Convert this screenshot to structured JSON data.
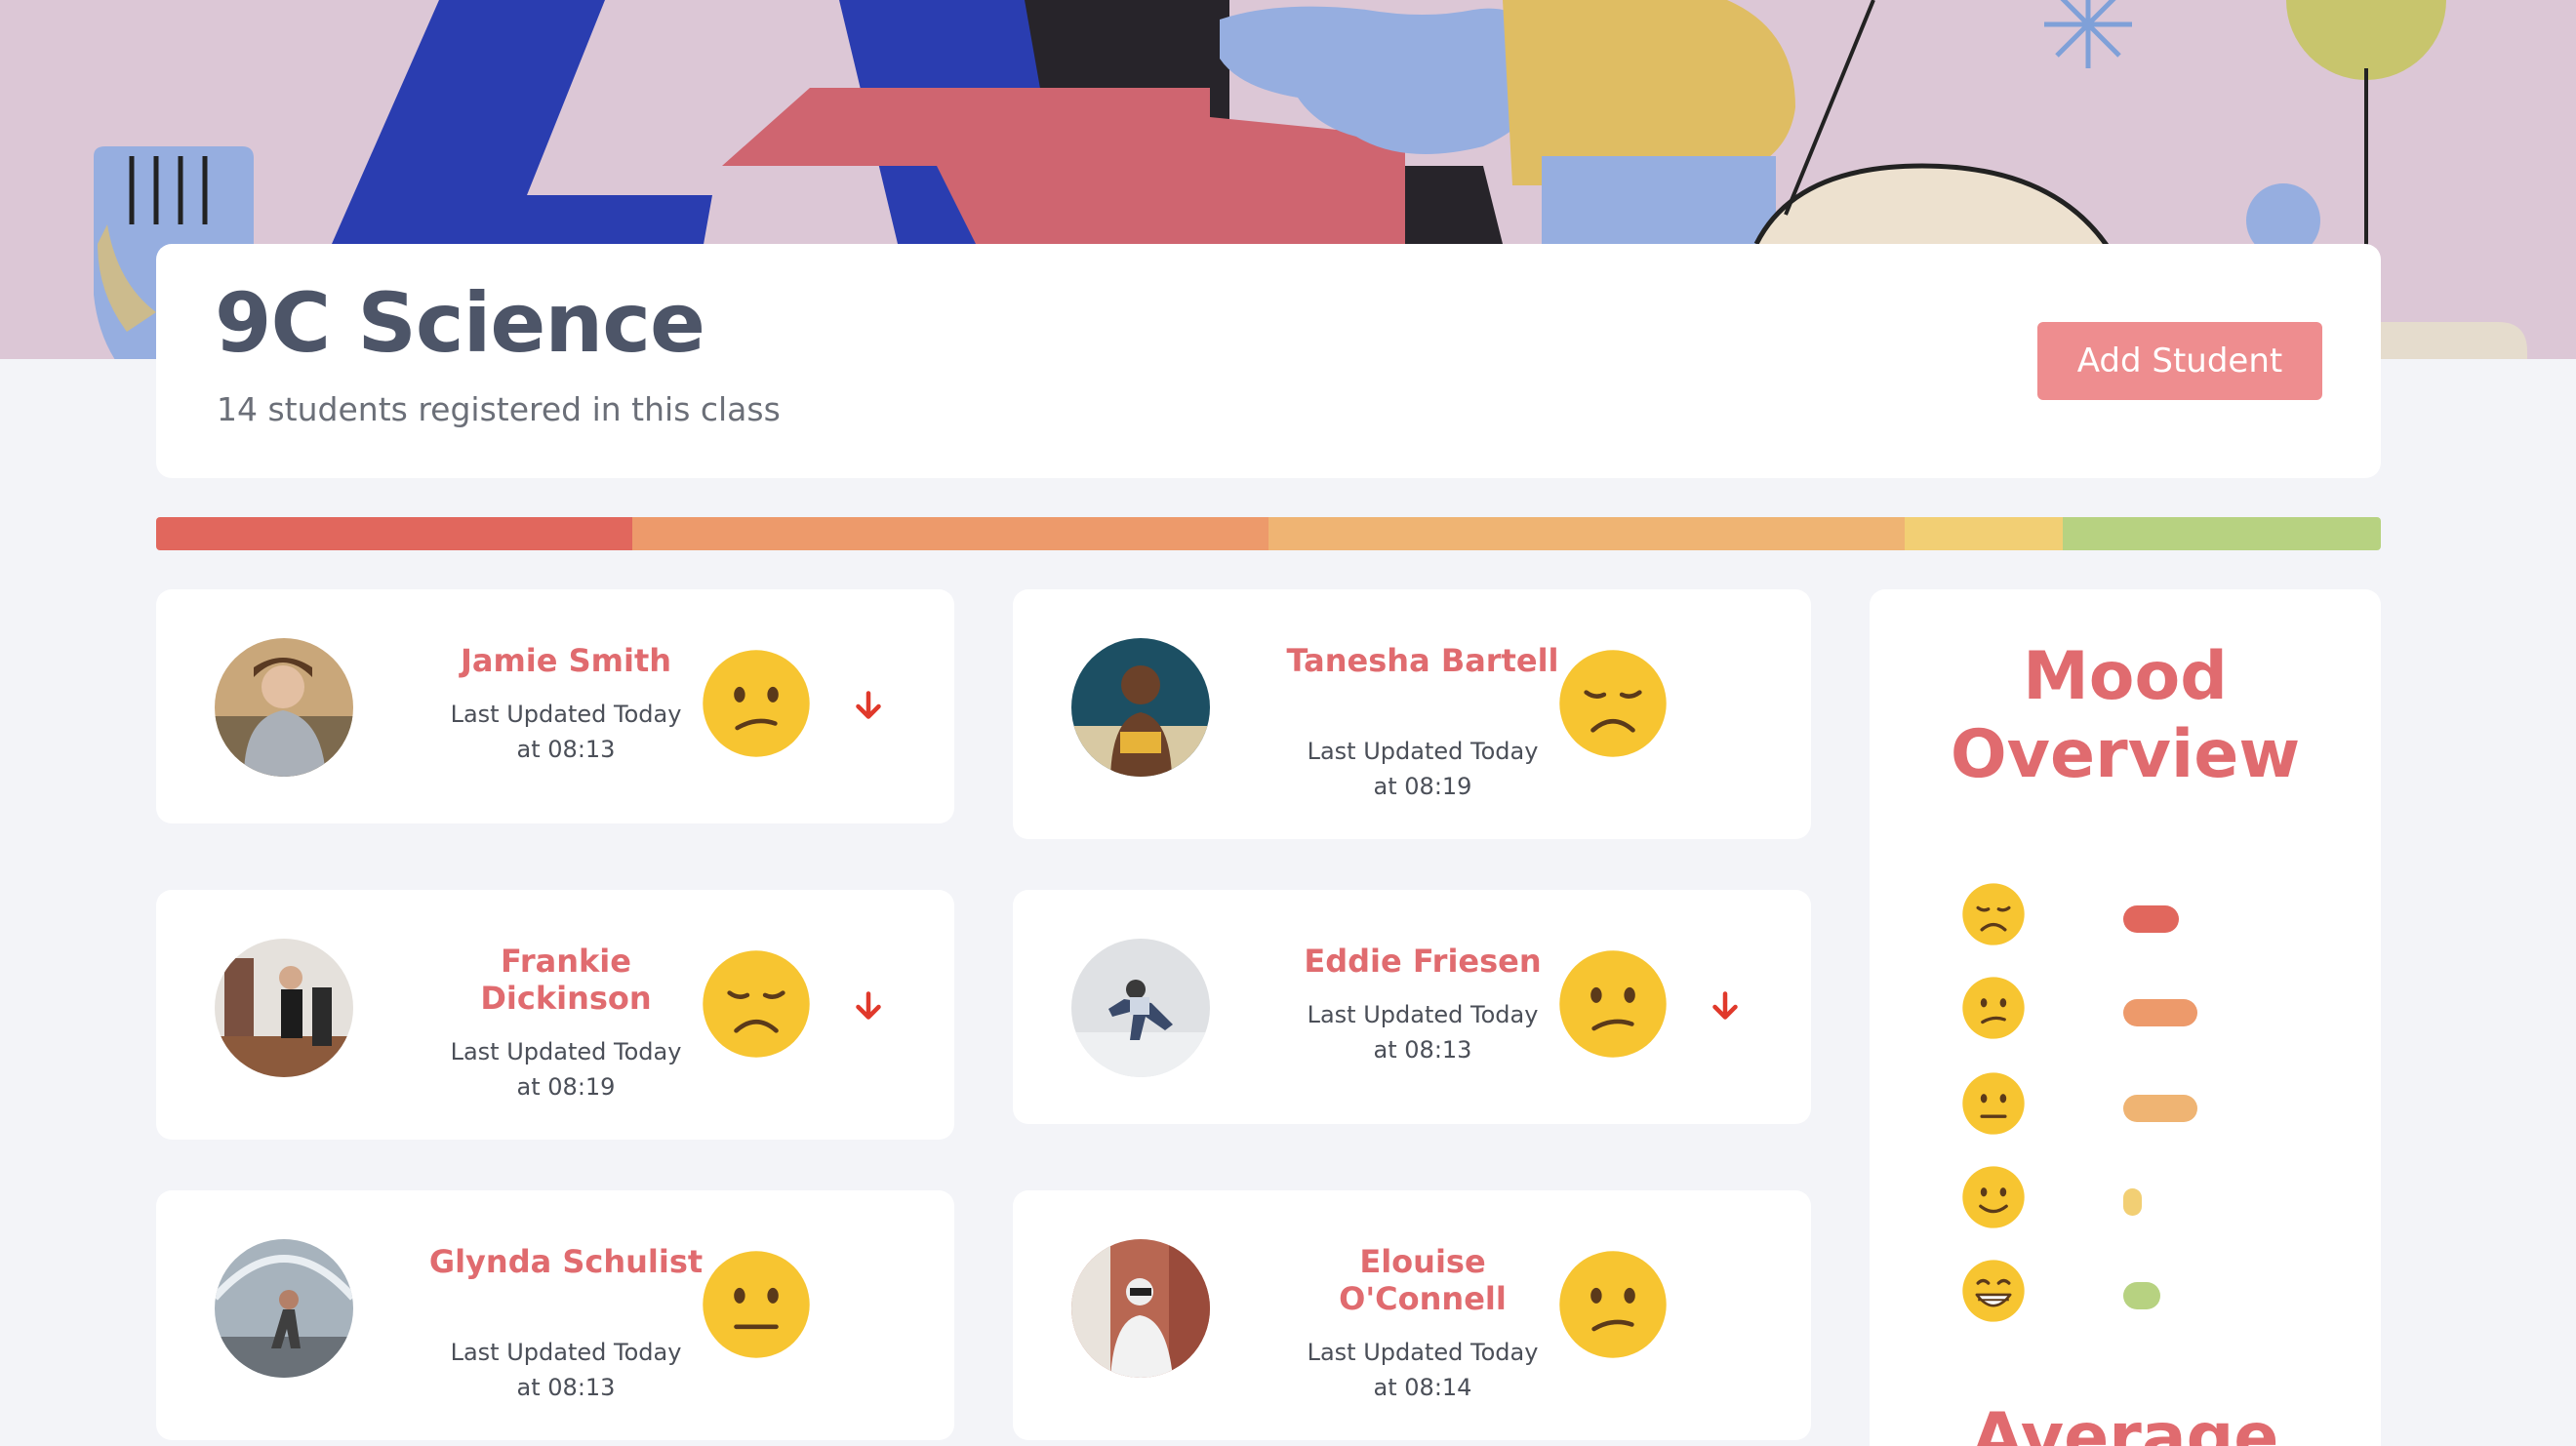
{
  "class": {
    "title": "9C Science",
    "subtitle": "14 students registered in this class",
    "add_button_label": "Add Student"
  },
  "mood_strip": [
    {
      "mood": "sad",
      "fraction": 0.214,
      "color": "#e1675d"
    },
    {
      "mood": "confused",
      "fraction": 0.286,
      "color": "#ed9a6b"
    },
    {
      "mood": "neutral",
      "fraction": 0.286,
      "color": "#efb473"
    },
    {
      "mood": "slightly-smiling",
      "fraction": 0.071,
      "color": "#f2cf74"
    },
    {
      "mood": "grinning",
      "fraction": 0.143,
      "color": "#b7d281"
    }
  ],
  "students": [
    {
      "name": "Jamie Smith",
      "updated_line1": "Last Updated Today",
      "updated_line2": "at 08:13",
      "mood": "confused-face-icon",
      "trend": "down"
    },
    {
      "name": "Tanesha Bartell",
      "updated_line1": "Last Updated Today",
      "updated_line2": "at 08:19",
      "mood": "disappointed-face-icon",
      "trend": "none"
    },
    {
      "name": "Frankie Dickinson",
      "updated_line1": "Last Updated Today",
      "updated_line2": "at 08:19",
      "mood": "disappointed-face-icon",
      "trend": "down"
    },
    {
      "name": "Eddie Friesen",
      "updated_line1": "Last Updated Today",
      "updated_line2": "at 08:13",
      "mood": "confused-face-icon",
      "trend": "down"
    },
    {
      "name": "Glynda Schulist",
      "updated_line1": "Last Updated Today",
      "updated_line2": "at 08:13",
      "mood": "neutral-face-icon",
      "trend": "none"
    },
    {
      "name": "Elouise O'Connell",
      "updated_line1": "Last Updated Today",
      "updated_line2": "at 08:14",
      "mood": "confused-face-icon",
      "trend": "none"
    }
  ],
  "overview": {
    "title": "Mood Overview",
    "rows": [
      {
        "mood": "disappointed-face-icon",
        "count": 3,
        "color": "#e1675d"
      },
      {
        "mood": "confused-face-icon",
        "count": 4,
        "color": "#ed9a6b"
      },
      {
        "mood": "neutral-face-icon",
        "count": 4,
        "color": "#efb473"
      },
      {
        "mood": "slightly-smiling-face-icon",
        "count": 1,
        "color": "#f2cf74"
      },
      {
        "mood": "grinning-face-icon",
        "count": 2,
        "color": "#b7d281"
      }
    ],
    "next_section_title": "Average"
  }
}
